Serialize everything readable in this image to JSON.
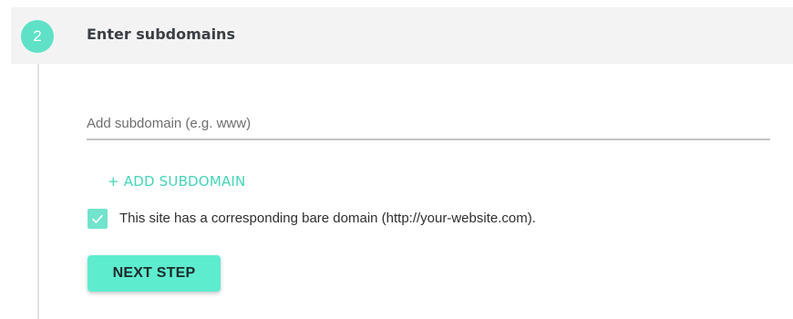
{
  "step": {
    "number": "2",
    "title": "Enter subdomains"
  },
  "subdomain_input": {
    "placeholder": "Add subdomain (e.g. www)",
    "value": ""
  },
  "add_subdomain_label": "+ ADD SUBDOMAIN",
  "bare_domain_checkbox": {
    "checked": true,
    "label": "This site has a corresponding bare domain (http://your-website.com)."
  },
  "next_step_label": "NEXT STEP",
  "colors": {
    "accent": "#5ee1c6",
    "link": "#45d4b8",
    "button": "#5eeccf",
    "header_background": "#f3f3f3"
  },
  "icons": {
    "checkbox_check": "checkmark-icon"
  }
}
